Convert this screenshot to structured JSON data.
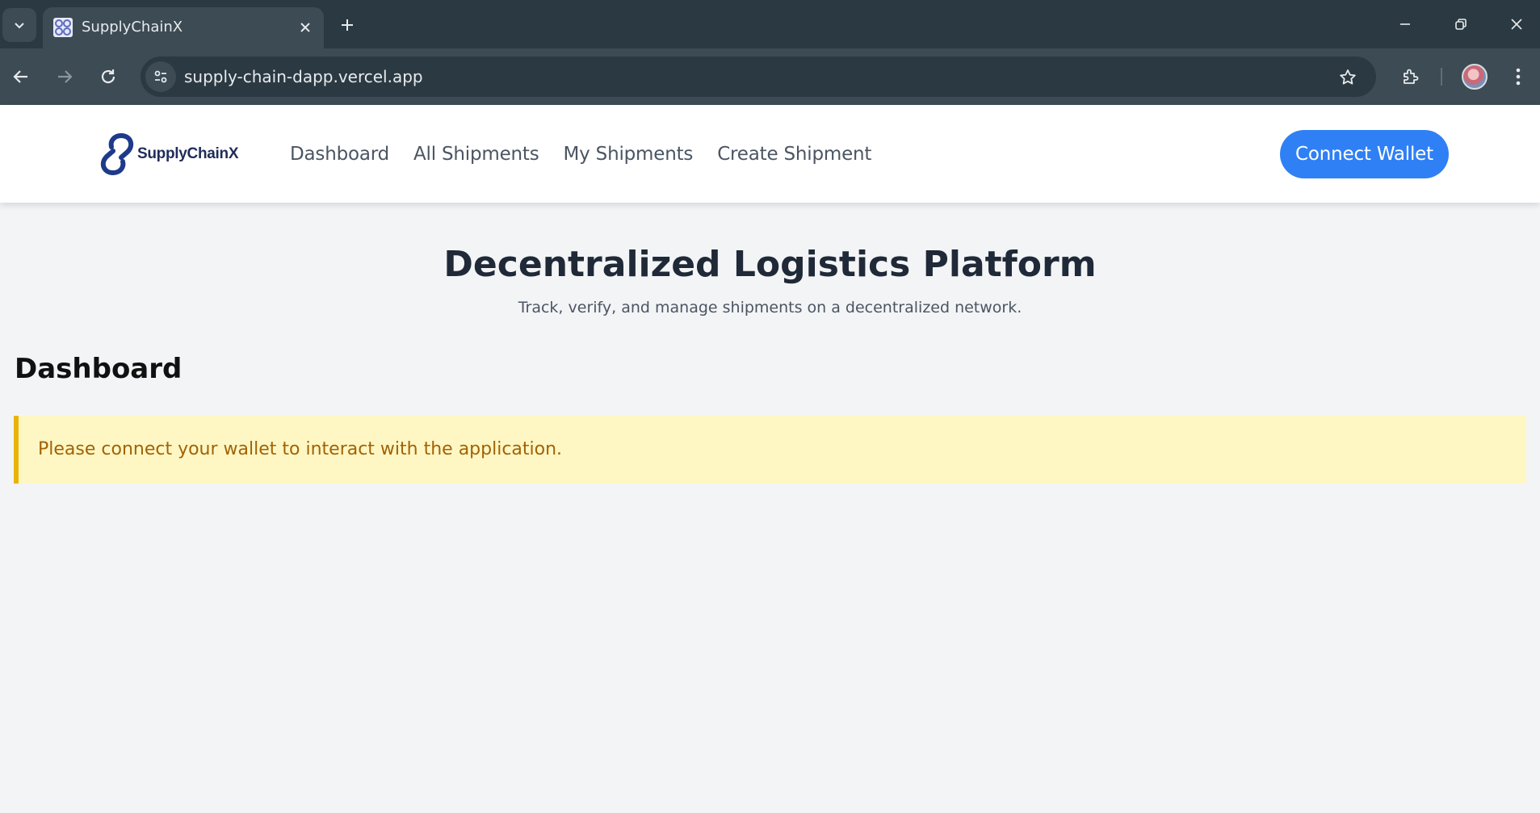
{
  "browser": {
    "tab_title": "SupplyChainX",
    "url": "supply-chain-dapp.vercel.app",
    "icons": [
      "tab-search-icon",
      "favicon-icon",
      "close-icon",
      "plus-icon",
      "minimize-icon",
      "restore-icon",
      "close-window-icon",
      "back-arrow-icon",
      "forward-arrow-icon",
      "reload-icon",
      "site-info-icon",
      "star-icon",
      "extensions-icon",
      "avatar",
      "more-vert-icon"
    ]
  },
  "app": {
    "logo_text": "SupplyChainX",
    "nav": {
      "items": [
        {
          "label": "Dashboard"
        },
        {
          "label": "All Shipments"
        },
        {
          "label": "My Shipments"
        },
        {
          "label": "Create Shipment"
        }
      ]
    },
    "connect_label": "Connect Wallet",
    "hero": {
      "title": "Decentralized Logistics Platform",
      "subtitle": "Track, verify, and manage shipments on a decentralized network."
    },
    "section_title": "Dashboard",
    "alert_text": "Please connect your wallet to interact with the application.",
    "colors": {
      "primary": "#2f80f5",
      "alert_bg": "#fef7c3",
      "alert_border": "#eab308",
      "alert_text": "#a16207",
      "page_bg": "#f3f4f6"
    }
  }
}
